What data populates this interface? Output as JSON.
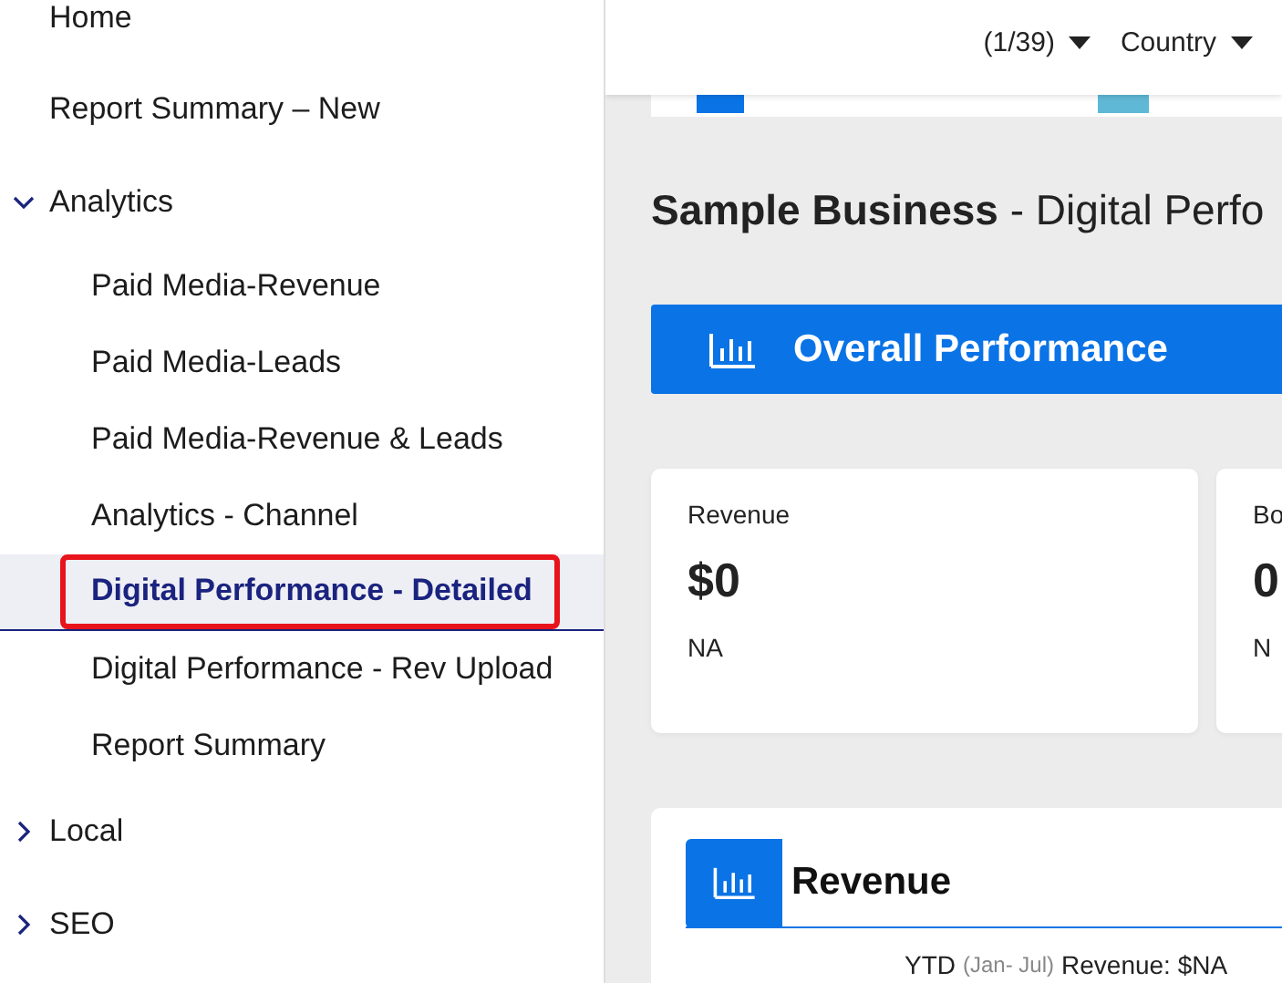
{
  "sidebar": {
    "items": [
      {
        "label": "Home",
        "selected": false
      },
      {
        "label": "Report Summary – New",
        "selected": false
      },
      {
        "label": "Analytics",
        "selected": false,
        "expanded": true,
        "children": [
          {
            "label": "Paid Media-Revenue",
            "selected": false
          },
          {
            "label": "Paid Media-Leads",
            "selected": false
          },
          {
            "label": "Paid Media-Revenue & Leads",
            "selected": false
          },
          {
            "label": "Analytics - Channel",
            "selected": false
          },
          {
            "label": "Digital Performance - Detailed",
            "selected": true
          },
          {
            "label": "Digital Performance - Rev Upload",
            "selected": false
          },
          {
            "label": "Report Summary",
            "selected": false
          }
        ]
      },
      {
        "label": "Local",
        "selected": false,
        "expanded": false
      },
      {
        "label": "SEO",
        "selected": false,
        "expanded": false
      }
    ]
  },
  "header": {
    "filters": [
      {
        "label": "(1/39)"
      },
      {
        "label": "Country"
      }
    ]
  },
  "title": "**Sample Business** - Digital Perfo",
  "banner": {
    "label": "Overall Performance"
  },
  "kpi_cards": [
    {
      "label": "Revenue",
      "value": "$0",
      "change": "NA"
    },
    {
      "label": "Bo",
      "value": "0",
      "change": "N"
    }
  ],
  "section": {
    "title": "Revenue",
    "period": "YTD",
    "range": "(Jan- Jul)",
    "text": "Revenue: $NA"
  }
}
